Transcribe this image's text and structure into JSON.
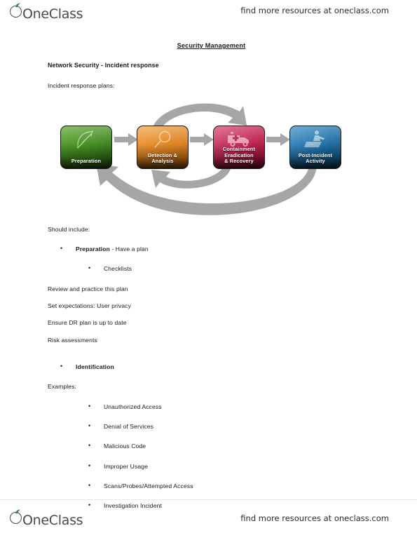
{
  "header": {
    "logo_text": "OneClass",
    "logo_icon": "oneclass-apple-logo",
    "tagline": "find more resources at oneclass.com"
  },
  "document": {
    "title": "Security Management",
    "section_heading": "Network Security - Incident response",
    "intro": "Incident response plans:",
    "should_include_label": "Should include:",
    "examples_label": "Examples:"
  },
  "diagram": {
    "name": "incident-response-lifecycle",
    "arrow_color": "#a6a6a6",
    "stages": [
      {
        "label_lines": [
          "Preparation"
        ],
        "color": "#3f8a1c",
        "icon": "bow-and-arrow-icon",
        "style_class": "box-green"
      },
      {
        "label_lines": [
          "Detection &",
          "Analysis"
        ],
        "color": "#e0821d",
        "icon": "magnifying-glass-icon",
        "style_class": "box-orange"
      },
      {
        "label_lines": [
          "Containment",
          "Eradication",
          "& Recovery"
        ],
        "color": "#c01e4c",
        "icon": "ambulance-icon",
        "style_class": "box-crimson"
      },
      {
        "label_lines": [
          "Post-Incident",
          "Activity"
        ],
        "color": "#1c6fa5",
        "icon": "person-presenting-icon",
        "style_class": "box-blue"
      }
    ]
  },
  "preparation_section": {
    "bullet_bold": "Preparation",
    "bullet_rest": " - Have a plan",
    "sub_bullet": "Checklists",
    "notes": [
      "Review and practice this plan",
      "Set expectations: User privacy",
      "Ensure DR plan is up to date",
      "Risk assessments"
    ]
  },
  "identification_section": {
    "bullet": "Identification",
    "examples": [
      "Unauthorized Access",
      "Denial of Services",
      "Malicious Code",
      "Improper Usage",
      "Scans/Probes/Attempted Access",
      "Investigation Incident"
    ]
  },
  "footer": {
    "logo_text": "OneClass",
    "logo_icon": "oneclass-apple-logo",
    "tagline": "find more resources at oneclass.com"
  }
}
